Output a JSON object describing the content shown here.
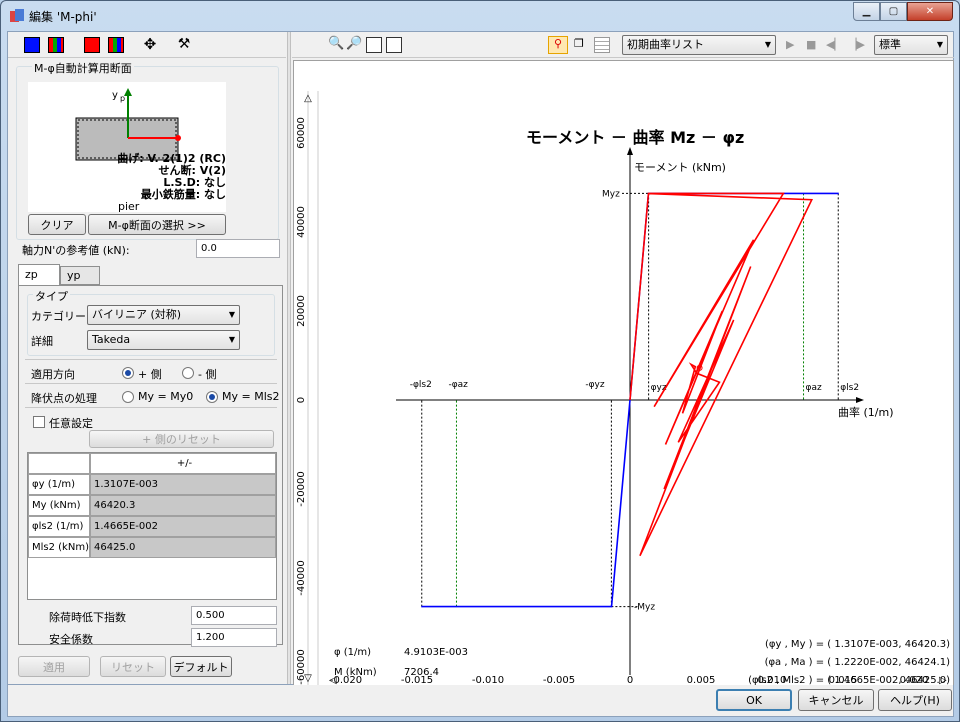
{
  "window": {
    "title": "編集 'M-phi'"
  },
  "left": {
    "section_title": "M-φ自動計算用断面",
    "preview": {
      "axis_label": "y",
      "axis_sub": "p",
      "line1": "曲げ: V. 2(1)2 (RC)",
      "line2": "せん断: V(2)",
      "line3": "L.S.D: なし",
      "line4": "最小鉄筋量: なし",
      "pier": "pier"
    },
    "clear_label": "クリア",
    "select_section_label": "M-φ断面の選択 >>",
    "axial_label": "軸力N'の参考値 (kN):",
    "axial_value": "0.0",
    "tabs": [
      "zp",
      "yp"
    ],
    "type_group": "タイプ",
    "category_label": "カテゴリー",
    "category_value": "バイリニア (対称)",
    "detail_label": "詳細",
    "detail_value": "Takeda",
    "direction_label": "適用方向",
    "dir_plus": "+ 側",
    "dir_minus": "- 側",
    "yield_label": "降伏点の処理",
    "yield_opt1": "My = My0",
    "yield_opt2": "My = Mls2",
    "custom_label": "任意設定",
    "reset_plus_label": "+ 側のリセット",
    "table_header": "+/-",
    "rows": [
      {
        "k": "φy (1/m)",
        "v": "1.3107E-003"
      },
      {
        "k": "My (kNm)",
        "v": "46420.3"
      },
      {
        "k": "φls2 (1/m)",
        "v": "1.4665E-002"
      },
      {
        "k": "Mls2 (kNm)",
        "v": "46425.0"
      }
    ],
    "unload_label": "除荷時低下指数",
    "unload_value": "0.500",
    "safety_label": "安全係数",
    "safety_value": "1.200",
    "apply": "適用",
    "reset": "リセット",
    "default": "デフォルト"
  },
  "toolbar": {
    "list_value": "初期曲率リスト",
    "mode_value": "標準"
  },
  "chart_data": {
    "type": "line",
    "title": "モーメント － 曲率 Mz － φz",
    "xlabel": "曲率 (1/m)",
    "ylabel": "モーメント (kNm)",
    "xlim": [
      -0.02,
      0.022
    ],
    "ylim": [
      -65000,
      70000
    ],
    "xticks": [
      "-0.020",
      "-0.015",
      "-0.010",
      "-0.005",
      "0",
      "0.005",
      "0.010",
      "0.015",
      "0.020"
    ],
    "yticks": [
      "60000",
      "40000",
      "20000",
      "0",
      "-20000",
      "-40000",
      "-60000"
    ],
    "skeleton": {
      "color": "#0000ff",
      "x": [
        -0.0147,
        -0.0013,
        0,
        0.0013,
        0.0147
      ],
      "y": [
        -46425,
        -46420,
        0,
        46420,
        46425
      ]
    },
    "hysteresis": {
      "color": "#ff0000",
      "x": [
        0,
        0.0013,
        0.0108,
        0.0017,
        0.0087,
        0.0025,
        0.0065,
        0.0037,
        0.0046,
        0.0043,
        0.0047,
        0.0063,
        0.0034,
        0.0073,
        0.0024,
        0.0085,
        0.0007,
        0.0128,
        0.0013
      ],
      "y": [
        0,
        46420,
        46420,
        -1500,
        36000,
        -10000,
        20000,
        -3000,
        7500,
        8000,
        6000,
        4000,
        -9500,
        18000,
        -20000,
        30000,
        -35000,
        45000,
        46400
      ]
    },
    "labels": [
      "-φls2",
      "-φaz",
      "-φyz",
      "φyz",
      "φaz",
      "φls2",
      "Myz",
      "-Myz"
    ],
    "readout": {
      "phi_label": "φ (1/m)",
      "phi_value": "4.9103E-003",
      "m_label": "M (kNm)",
      "m_value": "7206.4"
    },
    "legend": [
      "(φy , My ) = ( 1.3107E-003, 46420.3)",
      "(φa , Ma ) = ( 1.2220E-002, 46424.1)",
      "(φls2 , Mls2 ) = ( 1.4665E-002, 46425.0)"
    ]
  },
  "footer": {
    "ok": "OK",
    "cancel": "キャンセル",
    "help": "ヘルプ(H)"
  }
}
